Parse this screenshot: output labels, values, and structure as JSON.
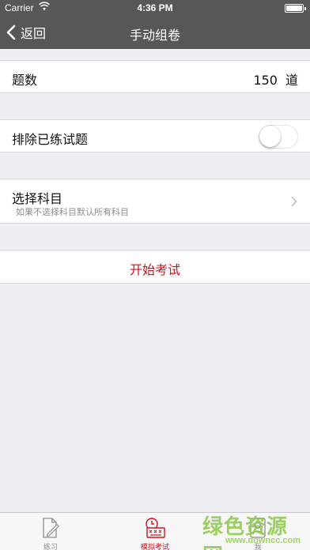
{
  "colors": {
    "nav_bg": "#575757",
    "accent_red": "#d0101c",
    "page_bg": "#efeff4",
    "tab_inactive": "#8e8e93",
    "watermark_green": "#8cc846"
  },
  "status_bar": {
    "carrier": "Carrier",
    "time": "4:36 PM",
    "battery_level": 1.0
  },
  "nav": {
    "back_label": "返回",
    "title": "手动组卷",
    "back_icon": "chevron-left-icon"
  },
  "rows": {
    "question_count": {
      "label": "题数",
      "value": "150",
      "unit": "道"
    },
    "exclude_practiced": {
      "label": "排除已练试题",
      "enabled": false
    },
    "subject": {
      "label": "选择科目",
      "subtitle": "如果不选择科目默认所有科目",
      "icon": "chevron-right-icon"
    },
    "start": {
      "label": "开始考试"
    }
  },
  "tabs": [
    {
      "label": "练习",
      "icon": "edit-document-icon",
      "active": false
    },
    {
      "label": "模拟考试",
      "icon": "exam-clock-icon",
      "active": true
    },
    {
      "label": "我",
      "icon": "person-icon",
      "active": false
    }
  ],
  "watermark": {
    "title": "绿色资源网",
    "url": "www.downcc.com"
  }
}
